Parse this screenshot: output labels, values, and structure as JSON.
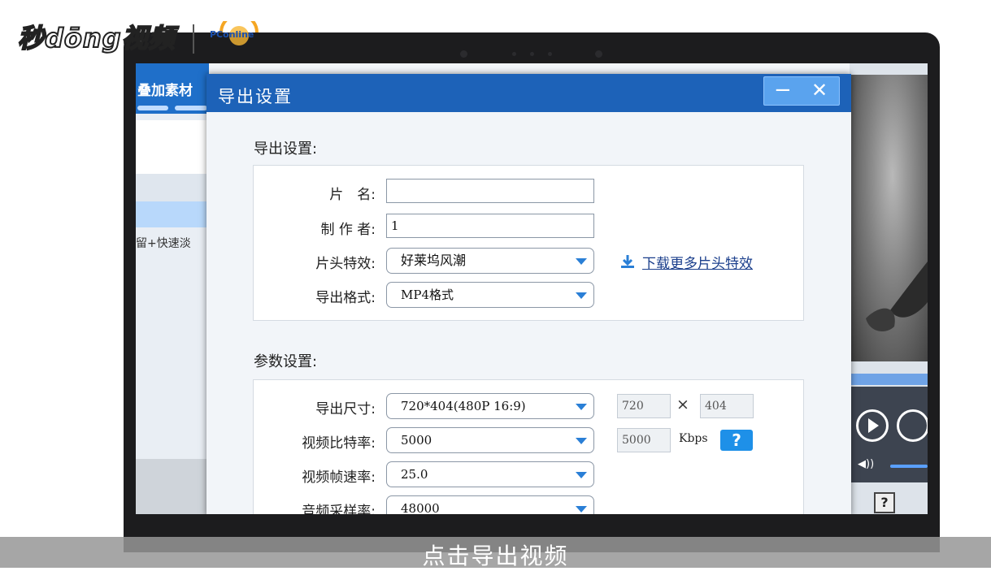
{
  "brand": {
    "name": "秒dōng视频",
    "partner": "PConline",
    "partner_sub": "太平洋电脑网"
  },
  "left_panel": {
    "title": "叠加素材",
    "item_text": "留+快速淡"
  },
  "dialog": {
    "title": "导出设置",
    "minimize": "−",
    "close": "✕",
    "export_section": {
      "heading": "导出设置:",
      "fields": {
        "name_label": "片　名:",
        "name_value": "",
        "author_label": "制 作 者:",
        "author_value": "1",
        "intro_label": "片头特效:",
        "intro_value": "好莱坞风潮",
        "format_label": "导出格式:",
        "format_value": "MP4格式"
      },
      "download_link": "下载更多片头特效"
    },
    "params_section": {
      "heading": "参数设置:",
      "size_label": "导出尺寸:",
      "size_value": "720*404(480P 16:9)",
      "width": "720",
      "times": "×",
      "height": "404",
      "bitrate_label": "视频比特率:",
      "bitrate_value": "5000",
      "bitrate_box": "5000",
      "bitrate_unit": "Kbps",
      "help": "?",
      "fps_label": "视频帧速率:",
      "fps_value": "25.0",
      "sample_label": "音频采样率:",
      "sample_value": "48000"
    }
  },
  "preview": {
    "help_button": "?"
  },
  "subtitle": "点击导出视频",
  "colors": {
    "dialog_blue": "#1d62b8",
    "accent": "#2a7fd6",
    "help_blue": "#1e90e8"
  }
}
